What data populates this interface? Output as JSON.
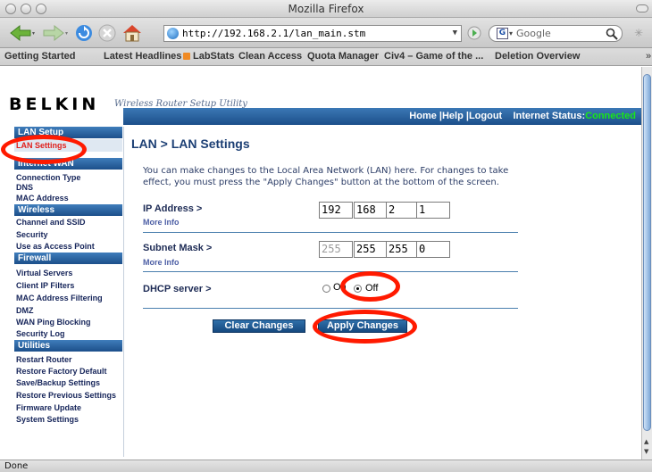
{
  "window": {
    "title": "Mozilla Firefox"
  },
  "toolbar": {
    "url": "http://192.168.2.1/lan_main.stm",
    "search_placeholder": "Google"
  },
  "bookmarks": [
    "Getting Started",
    "Latest Headlines",
    "LabStats",
    "Clean Access",
    "Quota Manager",
    "Civ4 – Game of the ...",
    "Deletion Overview"
  ],
  "page": {
    "logo": "BELKIN",
    "tagline": "Wireless Router Setup Utility",
    "topnav": {
      "links": "Home |Help |Logout",
      "status_label": "Internet Status:",
      "status_value": "Connected"
    },
    "sidebar": {
      "sections": [
        {
          "title": "LAN Setup",
          "items": [
            "LAN Settings"
          ]
        },
        {
          "title": "Internet WAN",
          "items": [
            "Connection Type",
            "DNS",
            "MAC Address"
          ]
        },
        {
          "title": "Wireless",
          "items": [
            "Channel and SSID",
            "Security",
            "Use as Access Point"
          ]
        },
        {
          "title": "Firewall",
          "items": [
            "Virtual Servers",
            "Client IP Filters",
            "MAC Address Filtering",
            "DMZ",
            "WAN Ping Blocking",
            "Security Log"
          ]
        },
        {
          "title": "Utilities",
          "items": [
            "Restart Router",
            "Restore Factory Default",
            "Save/Backup Settings",
            "Restore Previous Settings",
            "Firmware Update",
            "System Settings"
          ]
        }
      ],
      "active_item": "LAN Settings"
    },
    "heading": "LAN > LAN Settings",
    "intro": "You can make changes to the Local Area Network (LAN) here. For changes to take effect, you must press the \"Apply Changes\" button at the bottom of the screen.",
    "ip": {
      "label": "IP Address >",
      "more": "More Info",
      "octets": [
        "192",
        "168",
        "2",
        "1"
      ]
    },
    "subnet": {
      "label": "Subnet Mask >",
      "more": "More Info",
      "octets": [
        "255",
        "255",
        "255",
        "0"
      ]
    },
    "dhcp": {
      "label": "DHCP server >",
      "on_label": "On",
      "off_label": "Off",
      "selected": "Off"
    },
    "buttons": {
      "clear": "Clear Changes",
      "apply": "Apply Changes"
    }
  },
  "status": {
    "text": "Done"
  },
  "colors": {
    "belkin_blue": "#1c4f8a",
    "connected_green": "#19e619",
    "annotation_red": "#ff1a00",
    "active_red": "#e0201c"
  }
}
